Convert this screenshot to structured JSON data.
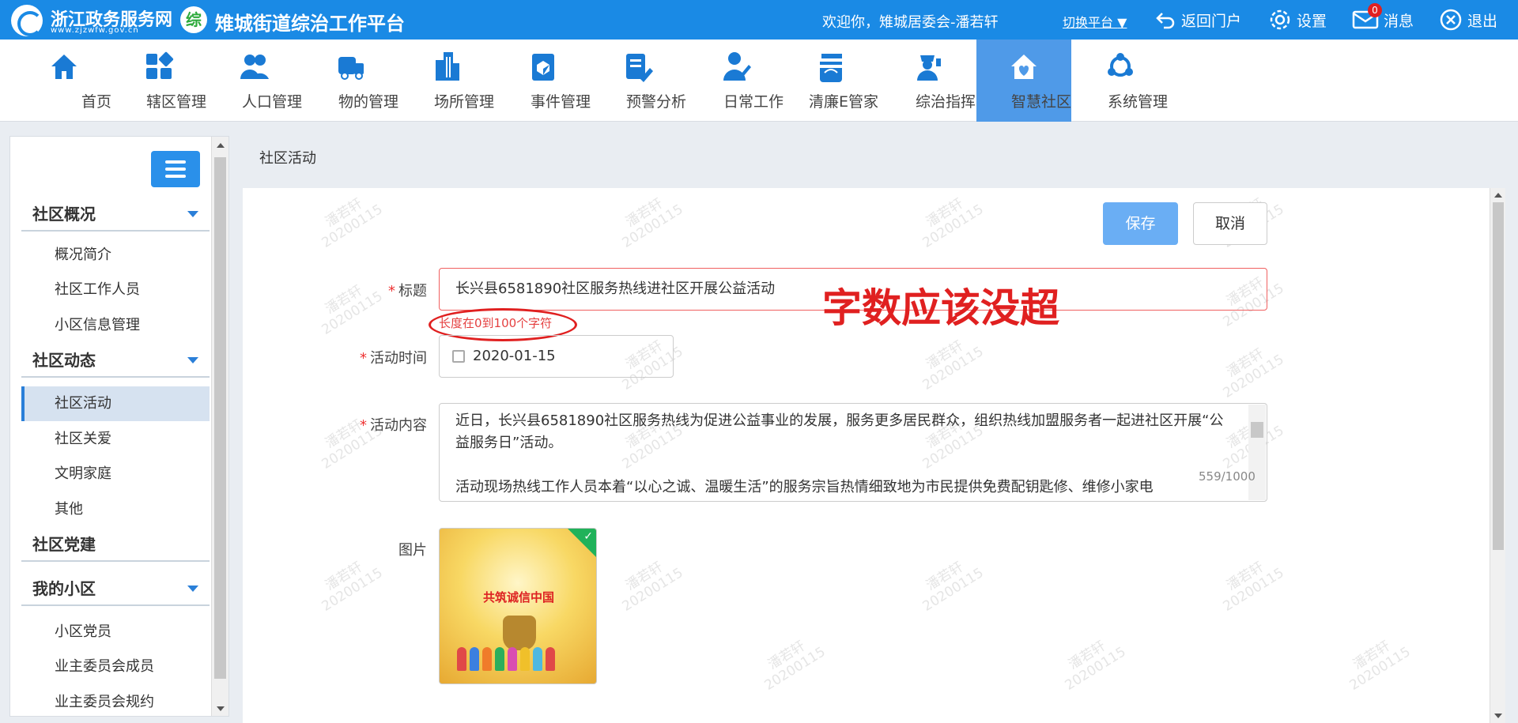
{
  "header": {
    "site_name": "浙江政务服务网",
    "site_url": "www.zjzwfw.gov.cn",
    "platform_name": "雉城街道综治工作平台",
    "welcome": "欢迎你，雉城居委会-潘若轩",
    "switch_platform": "切换平台",
    "return_portal": "返回门户",
    "settings": "设置",
    "messages": "消息",
    "message_count": "0",
    "logout": "退出"
  },
  "nav": {
    "items": [
      {
        "label": "首页",
        "icon": "home-icon"
      },
      {
        "label": "辖区管理",
        "icon": "grid-icon"
      },
      {
        "label": "人口管理",
        "icon": "people-icon"
      },
      {
        "label": "物的管理",
        "icon": "vehicle-icon"
      },
      {
        "label": "场所管理",
        "icon": "building-icon"
      },
      {
        "label": "事件管理",
        "icon": "event-icon"
      },
      {
        "label": "预警分析",
        "icon": "warning-icon"
      },
      {
        "label": "日常工作",
        "icon": "worker-icon"
      },
      {
        "label": "清廉E管家",
        "icon": "clean-icon"
      },
      {
        "label": "综治指挥",
        "icon": "command-icon"
      },
      {
        "label": "智慧社区",
        "icon": "community-icon"
      },
      {
        "label": "系统管理",
        "icon": "system-icon"
      }
    ],
    "active": "智慧社区"
  },
  "sidebar": {
    "groups": [
      {
        "label": "社区概况",
        "items": [
          "概况简介",
          "社区工作人员",
          "小区信息管理"
        ]
      },
      {
        "label": "社区动态",
        "items": [
          "社区活动",
          "社区关爱",
          "文明家庭",
          "其他"
        ]
      },
      {
        "label": "社区党建",
        "items": []
      },
      {
        "label": "我的小区",
        "items": [
          "小区党员",
          "业主委员会成员",
          "业主委员会规约"
        ]
      }
    ],
    "active_item": "社区活动"
  },
  "page": {
    "title": "社区活动",
    "save": "保存",
    "cancel": "取消",
    "watermark_name": "潘若轩",
    "watermark_date": "20200115"
  },
  "form": {
    "title_label": "标题",
    "title_value": "长兴县6581890社区服务热线进社区开展公益活动",
    "title_error": "长度在0到100个字符",
    "annotation": "字数应该没超",
    "time_label": "活动时间",
    "time_value": "2020-01-15",
    "content_label": "活动内容",
    "content_p1": "近日，长兴县6581890社区服务热线为促进公益事业的发展，服务更多居民群众，组织热线加盟服务者一起进社区开展“公益服务日”活动。",
    "content_p2": "活动现场热线工作人员本着“以心之诚、温暖生活”的服务宗旨热情细致地为市民提供免费配钥匙修、维修小家电",
    "content_counter": "559/1000",
    "image_label": "图片",
    "image_caption": "共筑诚信中国"
  }
}
